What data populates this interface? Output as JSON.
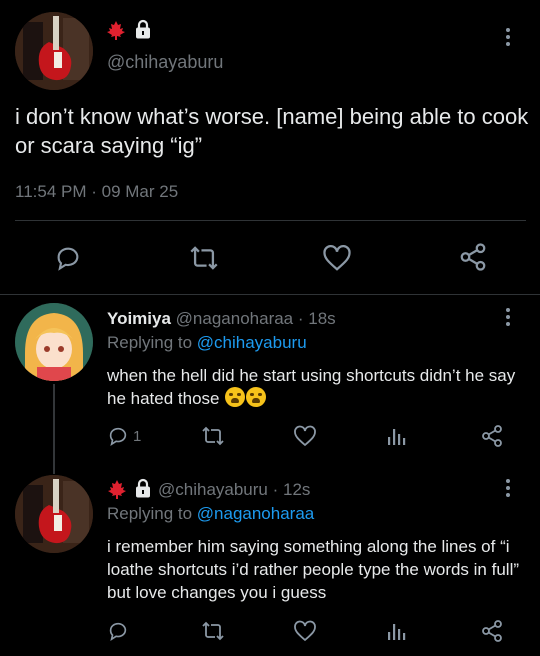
{
  "main_tweet": {
    "handle": "@chihayaburu",
    "text": "i don’t know what’s worse. [name] being able to cook or scara saying “ig”",
    "timestamp": "11:54 PM · 09 Mar 25"
  },
  "replies": [
    {
      "display_name": "Yoimiya",
      "handle_time": "@naganoharaa · 18s",
      "replying_label": "Replying to ",
      "replying_to": "@chihayaburu",
      "text": "when the hell did he start using shortcuts didn’t he say he hated those",
      "reply_count": "1"
    },
    {
      "handle_time": "@chihayaburu · 12s",
      "replying_label": "Replying to ",
      "replying_to": "@naganoharaa",
      "text": "i remember him saying something along the lines of “i loathe shortcuts i’d rather people type the words in full” but love changes you i guess"
    }
  ],
  "icons": [
    "maple-leaf-icon",
    "lock-icon",
    "more-icon",
    "reply-icon",
    "retweet-icon",
    "like-icon",
    "share-icon",
    "analytics-icon",
    "loudly-crying-face-emoji"
  ],
  "colors": {
    "background": "#000000",
    "text": "#e7e9ea",
    "muted": "#71767b",
    "link": "#1d9bf0",
    "maple": "#e0212f"
  }
}
